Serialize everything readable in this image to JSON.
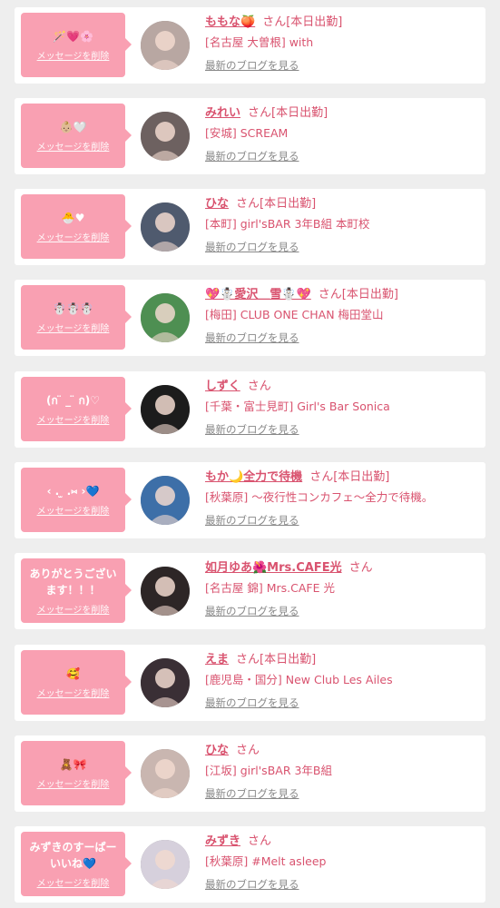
{
  "colors": {
    "accent": "#f9a0b2",
    "name": "#d9536f",
    "link": "#888888",
    "background": "#eeeeee"
  },
  "items": [
    {
      "message": "🪄💗🌸",
      "delete_label": "メッセージを削除",
      "avatar_color": "#b8a7a2",
      "name": "ももな🍑",
      "san": "さん",
      "attendance": "[本日出勤]",
      "shop": "[名古屋 大曽根] with",
      "blog_label": "最新のブログを見る"
    },
    {
      "message": "👶🏼🤍",
      "delete_label": "メッセージを削除",
      "avatar_color": "#6d6160",
      "name": "みれい",
      "san": "さん",
      "attendance": "[本日出勤]",
      "shop": "[安城] SCREAM",
      "blog_label": "最新のブログを見る"
    },
    {
      "message": "🐣♥",
      "delete_label": "メッセージを削除",
      "avatar_color": "#4f5a6e",
      "name": "ひな",
      "san": "さん",
      "attendance": "[本日出勤]",
      "shop": "[本町] girl'sBAR 3年B組 本町校",
      "blog_label": "最新のブログを見る"
    },
    {
      "message": "☃️☃️☃️",
      "delete_label": "メッセージを削除",
      "avatar_color": "#4e8f52",
      "name": "💖☃️愛沢＿雪☃️💖",
      "san": "さん",
      "attendance": "[本日出勤]",
      "shop": "[梅田] CLUB ONE CHAN 梅田堂山",
      "blog_label": "最新のブログを見る"
    },
    {
      "message": "(ก ̈ _ ̈ ก)♡",
      "delete_label": "メッセージを削除",
      "avatar_color": "#1c1c1c",
      "name": "しずく",
      "san": "さん",
      "attendance": "",
      "shop": "[千葉・富士見町] Girl's Bar Sonica",
      "blog_label": "最新のブログを見る"
    },
    {
      "message": "‹ . ̫ .⑅ ›💙",
      "delete_label": "メッセージを削除",
      "avatar_color": "#3d6fa8",
      "name": "もか🌙全力で待機",
      "san": "さん",
      "attendance": "[本日出勤]",
      "shop": "[秋葉原] 〜夜行性コンカフェ〜全力で待機。",
      "blog_label": "最新のブログを見る"
    },
    {
      "message": "ありがとうございます！！！",
      "delete_label": "メッセージを削除",
      "avatar_color": "#2d2626",
      "name": "如月ゆあ🌺Mrs.CAFE光",
      "san": "さん",
      "attendance": "",
      "shop": "[名古屋 錦] Mrs.CAFE 光",
      "blog_label": "最新のブログを見る"
    },
    {
      "message": "🥰",
      "delete_label": "メッセージを削除",
      "avatar_color": "#3a2f35",
      "name": "えま",
      "san": "さん",
      "attendance": "[本日出勤]",
      "shop": "[鹿児島・国分] New Club Les Ailes",
      "blog_label": "最新のブログを見る"
    },
    {
      "message": "🧸🎀",
      "delete_label": "メッセージを削除",
      "avatar_color": "#c9b6b0",
      "name": "ひな",
      "san": "さん",
      "attendance": "",
      "shop": "[江坂] girl'sBAR 3年B組",
      "blog_label": "最新のブログを見る"
    },
    {
      "message": "みずきのすーぱーいいね💙",
      "delete_label": "メッセージを削除",
      "avatar_color": "#d6d0dc",
      "name": "みずき",
      "san": "さん",
      "attendance": "",
      "shop": "[秋葉原] #Melt asleep",
      "blog_label": "最新のブログを見る"
    }
  ]
}
